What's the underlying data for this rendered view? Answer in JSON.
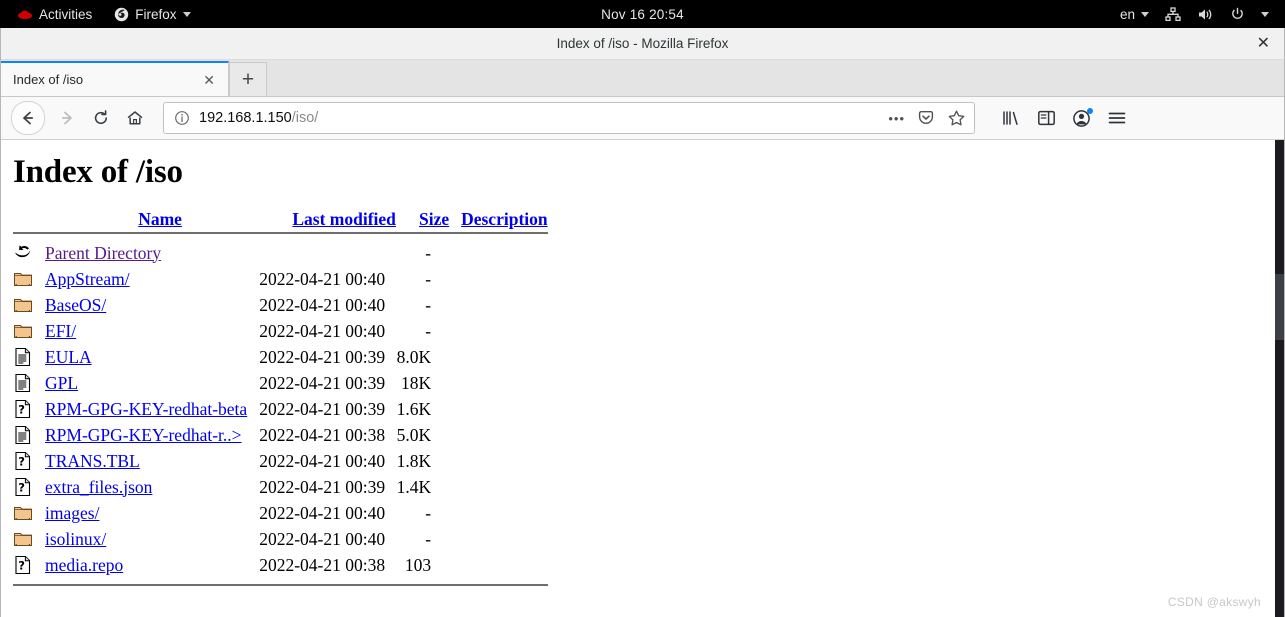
{
  "desktop": {
    "activities_label": "Activities",
    "app_menu_label": "Firefox",
    "clock": "Nov 16  20:54",
    "keyboard_layout": "en",
    "status_icons": [
      "network-icon",
      "volume-icon",
      "power-icon",
      "chevron-down-icon"
    ]
  },
  "window": {
    "title": "Index of /iso - Mozilla Firefox",
    "close_label": "✕"
  },
  "browser": {
    "tab": {
      "title": "Index of /iso",
      "close_label": "✕"
    },
    "newtab_label": "+",
    "nav": {
      "back_label": "←",
      "forward_label": "→",
      "reload_label": "⟳",
      "home_label": "⌂"
    },
    "urlbar": {
      "host": "192.168.1.150",
      "path": "/iso/",
      "identity_icon": "info-icon",
      "page_actions_label": "•••",
      "pocket_icon": "pocket-icon",
      "bookmark_icon": "star-icon"
    },
    "toolbar_right": {
      "library_icon": "library-icon",
      "sidebar_icon": "sidebar-icon",
      "account_icon": "account-icon",
      "menu_icon": "hamburger-menu-icon"
    }
  },
  "page": {
    "heading": "Index of /iso",
    "columns": {
      "name": "Name",
      "last_modified": "Last modified",
      "size": "Size",
      "description": "Description"
    },
    "rows": [
      {
        "icon": "back-arrow-icon",
        "name": "Parent Directory",
        "visited": true,
        "last_modified": "",
        "size": "-",
        "description": ""
      },
      {
        "icon": "folder-icon",
        "name": "AppStream/",
        "visited": false,
        "last_modified": "2022-04-21 00:40",
        "size": "-",
        "description": ""
      },
      {
        "icon": "folder-icon",
        "name": "BaseOS/",
        "visited": false,
        "last_modified": "2022-04-21 00:40",
        "size": "-",
        "description": ""
      },
      {
        "icon": "folder-icon",
        "name": "EFI/",
        "visited": false,
        "last_modified": "2022-04-21 00:40",
        "size": "-",
        "description": ""
      },
      {
        "icon": "text-file-icon",
        "name": "EULA",
        "visited": false,
        "last_modified": "2022-04-21 00:39",
        "size": "8.0K",
        "description": ""
      },
      {
        "icon": "text-file-icon",
        "name": "GPL",
        "visited": false,
        "last_modified": "2022-04-21 00:39",
        "size": "18K",
        "description": ""
      },
      {
        "icon": "unknown-file-icon",
        "name": "RPM-GPG-KEY-redhat-beta",
        "visited": false,
        "last_modified": "2022-04-21 00:39",
        "size": "1.6K",
        "description": ""
      },
      {
        "icon": "text-file-icon",
        "name": "RPM-GPG-KEY-redhat-r..>",
        "visited": false,
        "last_modified": "2022-04-21 00:38",
        "size": "5.0K",
        "description": ""
      },
      {
        "icon": "unknown-file-icon",
        "name": "TRANS.TBL",
        "visited": false,
        "last_modified": "2022-04-21 00:40",
        "size": "1.8K",
        "description": ""
      },
      {
        "icon": "unknown-file-icon",
        "name": "extra_files.json",
        "visited": false,
        "last_modified": "2022-04-21 00:39",
        "size": "1.4K",
        "description": ""
      },
      {
        "icon": "folder-icon",
        "name": "images/",
        "visited": false,
        "last_modified": "2022-04-21 00:40",
        "size": "-",
        "description": ""
      },
      {
        "icon": "folder-icon",
        "name": "isolinux/",
        "visited": false,
        "last_modified": "2022-04-21 00:40",
        "size": "-",
        "description": ""
      },
      {
        "icon": "unknown-file-icon",
        "name": "media.repo",
        "visited": false,
        "last_modified": "2022-04-21 00:38",
        "size": "103",
        "description": ""
      }
    ],
    "watermark": "CSDN @akswyh"
  },
  "colors": {
    "link": "#0000ee",
    "visited_link": "#551a8b",
    "tab_accent": "#0a84ff",
    "topbar_bg": "#000000",
    "folder": "#f5c98a"
  }
}
